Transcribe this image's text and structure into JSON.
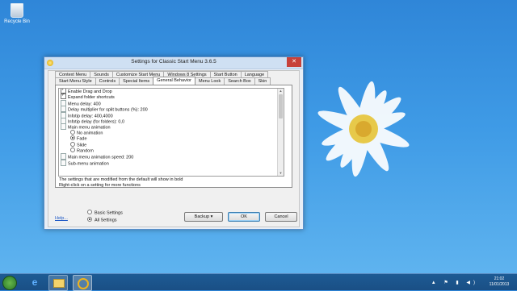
{
  "desktop": {
    "recycle_bin_label": "Recycle Bin"
  },
  "window": {
    "title": "Settings for Classic Start Menu 3.6.5",
    "close_symbol": "✕",
    "tabs_row1": [
      "Context Menu",
      "Sounds",
      "Customize Start Menu",
      "Windows 8 Settings",
      "Start Button",
      "Language"
    ],
    "tabs_row2": [
      "Start Menu Style",
      "Controls",
      "Special Items",
      "General Behavior",
      "Menu Look",
      "Search Box",
      "Skin"
    ],
    "active_tab": "General Behavior",
    "settings": [
      {
        "type": "check",
        "checked": true,
        "label": "Enable Drag and Drop"
      },
      {
        "type": "check",
        "checked": true,
        "label": "Expand folder shortcuts"
      },
      {
        "type": "value",
        "label": "Menu delay: 400"
      },
      {
        "type": "value",
        "label": "Delay multiplier for split buttons (%): 200"
      },
      {
        "type": "value",
        "label": "Infotip delay: 400,4000"
      },
      {
        "type": "value",
        "label": "Infotip delay (for folders): 0,0"
      },
      {
        "type": "value",
        "label": "Main menu animation"
      },
      {
        "type": "radio",
        "selected": false,
        "label": "No animation"
      },
      {
        "type": "radio",
        "selected": true,
        "label": "Fade"
      },
      {
        "type": "radio",
        "selected": false,
        "label": "Slide"
      },
      {
        "type": "radio",
        "selected": false,
        "label": "Random"
      },
      {
        "type": "value",
        "label": "Main menu animation speed: 200"
      },
      {
        "type": "value",
        "label": "Sub-menu animation"
      }
    ],
    "hint_line1": "The settings that are modified from the default will show in bold",
    "hint_line2": "Right-click on a setting for more functions",
    "help_link": "Help...",
    "mode_basic": "Basic Settings",
    "mode_all": "All Settings",
    "backup_label": "Backup",
    "ok_label": "OK",
    "cancel_label": "Cancel"
  },
  "taskbar": {
    "tray_icons": "▲ ⚑ ▮ ◀)",
    "time": "21:02",
    "date": "11/01/2013"
  }
}
